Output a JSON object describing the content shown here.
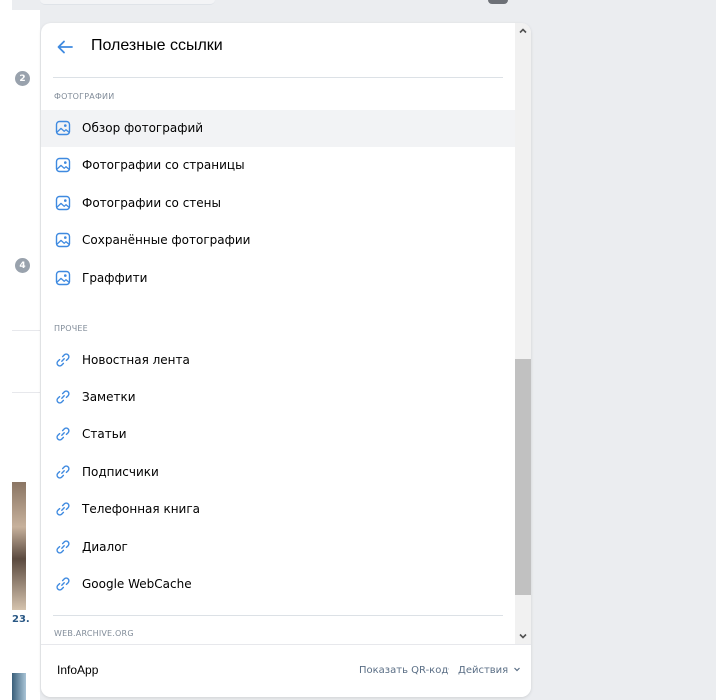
{
  "background": {
    "badges": [
      "2",
      "4"
    ],
    "thumb_text": "23."
  },
  "panel": {
    "title": "Полезные ссылки",
    "sections": [
      {
        "title": "Фотографии",
        "items": [
          {
            "label": "Обзор фотографий",
            "icon": "image-icon"
          },
          {
            "label": "Фотографии со страницы",
            "icon": "image-icon"
          },
          {
            "label": "Фотографии со стены",
            "icon": "image-icon"
          },
          {
            "label": "Сохранённые фотографии",
            "icon": "image-icon"
          },
          {
            "label": "Граффити",
            "icon": "image-icon"
          }
        ]
      },
      {
        "title": "Прочее",
        "items": [
          {
            "label": "Новостная лента",
            "icon": "link-icon"
          },
          {
            "label": "Заметки",
            "icon": "link-icon"
          },
          {
            "label": "Статьи",
            "icon": "link-icon"
          },
          {
            "label": "Подписчики",
            "icon": "link-icon"
          },
          {
            "label": "Телефонная книга",
            "icon": "link-icon"
          },
          {
            "label": "Диалог",
            "icon": "link-icon"
          },
          {
            "label": "Google WebCache",
            "icon": "link-icon"
          }
        ]
      },
      {
        "title": "web.archive.org",
        "items": []
      }
    ]
  },
  "footer": {
    "brand": "InfoApp",
    "qr_label": "Показать QR-код",
    "actions_label": "Действия",
    "separator": "·"
  },
  "colors": {
    "accent": "#3f8ae0",
    "icon_blue": "#3f8ae0",
    "section_title": "#818c99",
    "hover_row": "#f2f3f5",
    "link_muted": "#5a6e85"
  }
}
